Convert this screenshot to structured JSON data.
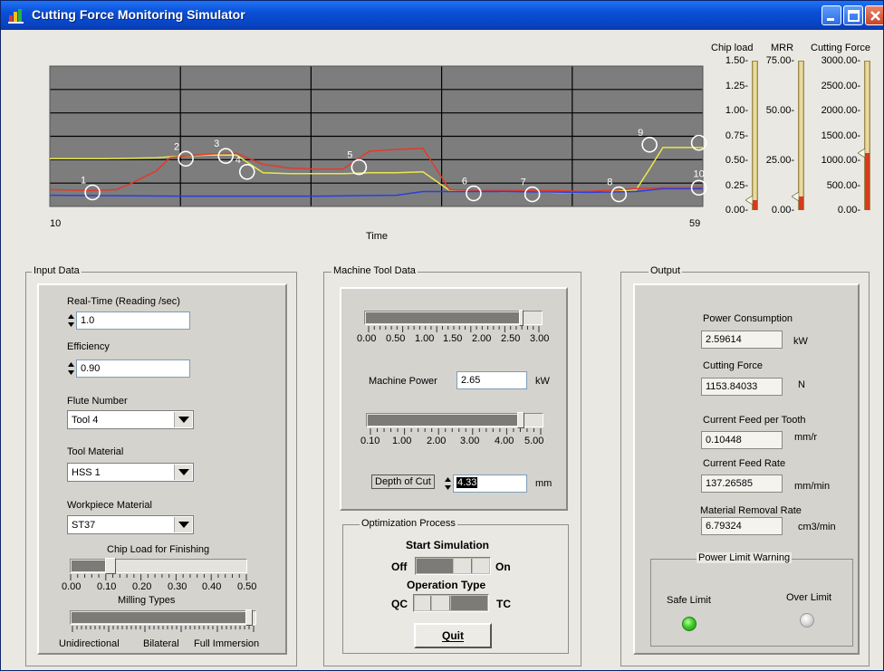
{
  "window": {
    "title": "Cutting Force Monitoring Simulator",
    "buttons": [
      "minimize",
      "maximize",
      "close"
    ]
  },
  "colors": {
    "titlebar": "#0a4fd6",
    "plot_bg": "#7d7d7d",
    "series_chip_load": "#e8e84a",
    "series_cutting_force": "#e23a2a",
    "series_mrr": "#2a3fe0",
    "gauge_fill": "#d83a1c",
    "led_safe": "#3fcf2a",
    "led_over": "#c9c9c9"
  },
  "plot": {
    "x_label": "Time",
    "x_start": "10",
    "x_end": "59",
    "markers": [
      "1",
      "2",
      "3",
      "4",
      "5",
      "6",
      "7",
      "8",
      "9",
      "10"
    ]
  },
  "chart_data": {
    "type": "line",
    "xlim": [
      10,
      59
    ],
    "xlabel": "Time",
    "grid": true,
    "series": [
      {
        "name": "",
        "color": "yellow",
        "x": [
          10,
          14,
          18,
          20,
          22,
          24,
          26,
          28,
          30,
          32,
          34,
          36,
          38,
          40,
          42,
          44,
          46,
          48,
          50,
          52,
          54,
          55,
          56,
          57,
          58,
          59
        ],
        "values": [
          0.51,
          0.51,
          0.52,
          0.54,
          0.55,
          0.55,
          0.36,
          0.35,
          0.35,
          0.35,
          0.36,
          0.36,
          0.37,
          0.17,
          0.17,
          0.16,
          0.16,
          0.15,
          0.15,
          0.16,
          0.18,
          0.4,
          0.63,
          0.63,
          0.63,
          0.63
        ]
      },
      {
        "name": "",
        "color": "red",
        "x": [
          10,
          13,
          15,
          16,
          18,
          19,
          20,
          22,
          24,
          26,
          28,
          30,
          32,
          34,
          36,
          38,
          40,
          42,
          44,
          46,
          48,
          50,
          52,
          54,
          56,
          58,
          59
        ],
        "values": [
          0.18,
          0.17,
          0.18,
          0.24,
          0.38,
          0.52,
          0.54,
          0.56,
          0.57,
          0.45,
          0.41,
          0.4,
          0.4,
          0.59,
          0.61,
          0.62,
          0.18,
          0.17,
          0.17,
          0.17,
          0.17,
          0.16,
          0.17,
          0.19,
          0.2,
          0.2,
          0.2
        ]
      },
      {
        "name": "",
        "color": "blue",
        "x": [
          10,
          20,
          30,
          36,
          38,
          44,
          50,
          54,
          56,
          59
        ],
        "values": [
          0.12,
          0.11,
          0.11,
          0.12,
          0.16,
          0.16,
          0.15,
          0.16,
          0.19,
          0.19
        ]
      }
    ],
    "annotations": [
      {
        "label": "1",
        "x": 13.2,
        "y": 0.15
      },
      {
        "label": "2",
        "x": 20.2,
        "y": 0.51
      },
      {
        "label": "3",
        "x": 23.2,
        "y": 0.54
      },
      {
        "label": "4",
        "x": 24.8,
        "y": 0.37
      },
      {
        "label": "5",
        "x": 33.2,
        "y": 0.42
      },
      {
        "label": "6",
        "x": 41.8,
        "y": 0.14
      },
      {
        "label": "7",
        "x": 46.2,
        "y": 0.13
      },
      {
        "label": "8",
        "x": 52.7,
        "y": 0.13
      },
      {
        "label": "9",
        "x": 55.0,
        "y": 0.66
      },
      {
        "label": "10",
        "x": 58.7,
        "y": 0.2
      },
      {
        "label": "",
        "x": 58.7,
        "y": 0.68
      }
    ]
  },
  "gauges": [
    {
      "label": "Chip load",
      "ticks": [
        "1.50-",
        "1.25-",
        "1.00-",
        "0.75-",
        "0.50-",
        "0.25-",
        "0.00-"
      ],
      "max": 1.5,
      "value": 0.1
    },
    {
      "label": "MRR",
      "ticks": [
        "75.00-",
        "",
        "50.00-",
        "",
        "25.00-",
        "",
        "0.00-"
      ],
      "max": 75,
      "value": 6.79
    },
    {
      "label": "Cutting Force",
      "ticks": [
        "3000.00-",
        "2500.00-",
        "2000.00-",
        "1500.00-",
        "1000.00-",
        "500.00-",
        "0.00-"
      ],
      "max": 3000,
      "value": 1153.84
    }
  ],
  "input_data": {
    "title": "Input Data",
    "realtime_label": "Real-Time (Reading /sec)",
    "realtime_value": "1.0",
    "efficiency_label": "Efficiency",
    "efficiency_value": "0.90",
    "flute_label": "Flute Number",
    "flute_value": "Tool 4",
    "tool_material_label": "Tool Material",
    "tool_material_value": "HSS 1",
    "workpiece_label": "Workpiece Material",
    "workpiece_value": "ST37",
    "chipload_label": "Chip Load for Finishing",
    "chipload_ticks": [
      "0.00",
      "0.10",
      "0.20",
      "0.30",
      "0.40",
      "0.50"
    ],
    "chipload_value": 0.1,
    "milling_label": "Milling Types",
    "milling_options": [
      "Unidirectional",
      "Bilateral",
      "Full Immersion"
    ],
    "milling_value": 1.0
  },
  "machine_data": {
    "title": "Machine Tool Data",
    "power_ticks": [
      "0.00",
      "0.50",
      "1.00",
      "1.50",
      "2.00",
      "2.50",
      "3.00"
    ],
    "power_fraction": 0.883,
    "power_label": "Machine Power",
    "power_value": "2.65",
    "power_unit": "kW",
    "depth_ticks": [
      "0.10",
      "1.00",
      "2.00",
      "3.00",
      "4.00",
      "5.00"
    ],
    "depth_fraction": 0.865,
    "depth_label": "Depth of Cut",
    "depth_value": "4.33",
    "depth_unit": "mm"
  },
  "optimization": {
    "title": "Optimization Process",
    "start_label": "Start Simulation",
    "off_label": "Off",
    "on_label": "On",
    "operation_label": "Operation Type",
    "qc_label": "QC",
    "tc_label": "TC",
    "quit_label": "Quit"
  },
  "output": {
    "title": "Output",
    "power_label": "Power Consumption",
    "power_value": "2.59614",
    "power_unit": "kW",
    "force_label": "Cutting Force",
    "force_value": "1153.84033",
    "force_unit": "N",
    "feed_tooth_label": "Current Feed per Tooth",
    "feed_tooth_value": "0.10448",
    "feed_tooth_unit": "mm/r",
    "feed_rate_label": "Current Feed Rate",
    "feed_rate_value": "137.26585",
    "feed_rate_unit": "mm/min",
    "mrr_label": "Material Removal Rate",
    "mrr_value": "6.79324",
    "mrr_unit": "cm3/min",
    "limit_title": "Power Limit Warning",
    "safe_label": "Safe Limit",
    "over_label": "Over Limit"
  }
}
